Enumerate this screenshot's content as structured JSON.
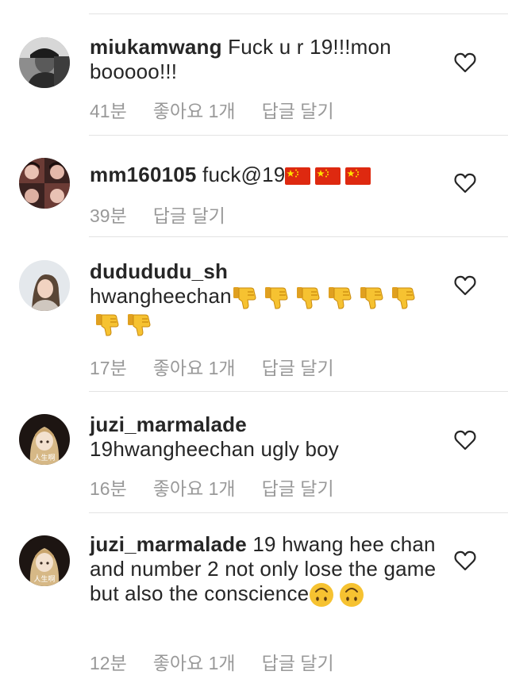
{
  "comments": [
    {
      "username": "miukamwang",
      "text": "Fuck u r 19!!!mon booooo!!!",
      "time": "41분",
      "likes": "좋아요 1개",
      "reply": "답글 달기",
      "avatar_icon": "profile-photo-bw"
    },
    {
      "username": "mm160105",
      "text": "fuck@19",
      "emoji": [
        "🇨🇳",
        "🇨🇳",
        "🇨🇳"
      ],
      "time": "39분",
      "reply": "답글 달기",
      "avatar_icon": "profile-photo-collage"
    },
    {
      "username": "dudududu_sh",
      "text": "hwangheechan",
      "emoji": [
        "👎",
        "👎",
        "👎",
        "👎",
        "👎",
        "👎",
        "👎",
        "👎"
      ],
      "time": "17분",
      "likes": "좋아요 1개",
      "reply": "답글 달기",
      "avatar_icon": "profile-photo-girl"
    },
    {
      "username": "juzi_marmalade",
      "text": "19hwangheechan ugly boy",
      "time": "16분",
      "likes": "좋아요 1개",
      "reply": "답글 달기",
      "avatar_icon": "profile-photo-anime",
      "avatar_caption": "人生啊"
    },
    {
      "username": "juzi_marmalade",
      "text": "19 hwang hee chan and number 2 not only lose the game but also the conscience",
      "emoji": [
        "🙃",
        "🙃"
      ],
      "time": "12분",
      "likes": "좋아요 1개",
      "reply": "답글 달기",
      "avatar_icon": "profile-photo-anime",
      "avatar_caption": "人生啊"
    }
  ],
  "colors": {
    "text": "#262626",
    "meta": "#999999",
    "divider": "#e3e3e3",
    "flag_red": "#de2910",
    "flag_star": "#ffde00",
    "emoji_yellow": "#f6c231"
  },
  "icons": {
    "like": "heart-outline-icon"
  }
}
